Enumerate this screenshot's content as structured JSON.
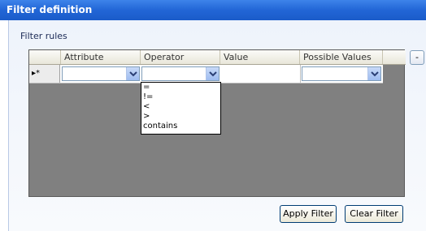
{
  "window": {
    "title": "Filter definition"
  },
  "group": {
    "label": "Filter rules"
  },
  "grid": {
    "columns": [
      "Attribute",
      "Operator",
      "Value",
      "Possible Values"
    ],
    "new_row_marker": "▸*"
  },
  "operator_dropdown": {
    "options": [
      "=",
      "!=",
      "<",
      ">",
      "contains"
    ]
  },
  "buttons": {
    "remove": "-",
    "apply_filter": "Apply Filter",
    "clear_filter": "Clear Filter"
  }
}
